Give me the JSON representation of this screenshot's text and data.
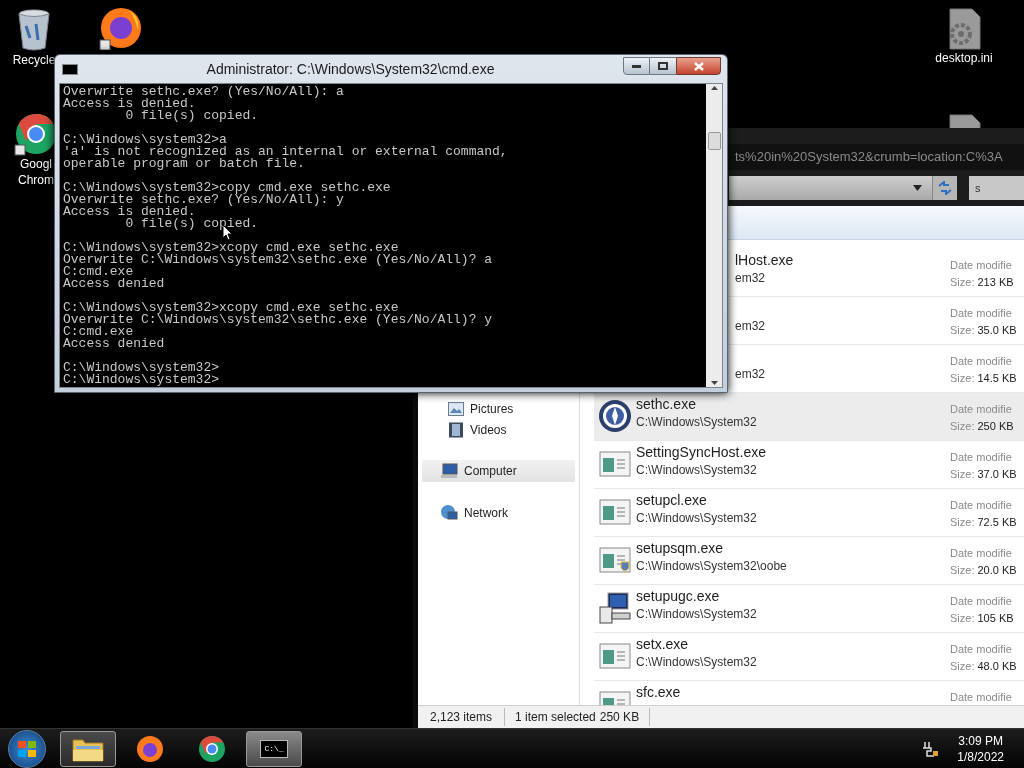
{
  "desktop_icons": [
    {
      "kind": "recycle-bin",
      "label_lines": [
        "Recycle"
      ]
    },
    {
      "kind": "firefox"
    },
    {
      "kind": "chrome",
      "label_lines": [
        "Googl",
        "Chrom"
      ]
    },
    {
      "kind": "settings-file",
      "label_lines": [
        "desktop.ini"
      ]
    },
    {
      "kind": "settings-file"
    }
  ],
  "explorer": {
    "address": "ts%20in%20System32&crumb=location:C%3A",
    "search": {
      "value": "s"
    },
    "nav_items": [
      {
        "label": "Pictures",
        "kind": "pictures",
        "selected": false
      },
      {
        "label": "Videos",
        "kind": "videos",
        "selected": false
      },
      {
        "label": "Computer",
        "kind": "computer",
        "selected": true
      },
      {
        "label": "Network",
        "kind": "network",
        "selected": false
      }
    ],
    "files": [
      {
        "kind": "hidden",
        "selected": false,
        "name": "lHost.exe",
        "path": "em32",
        "date_label": "Date modifie",
        "size_label": "Size:",
        "size": "213 KB"
      },
      {
        "kind": "hidden",
        "selected": false,
        "path": "em32",
        "date_label": "Date modifie",
        "size_label": "Size:",
        "size": "35.0 KB"
      },
      {
        "kind": "hidden",
        "selected": false,
        "path": "em32",
        "date_label": "Date modifie",
        "size_label": "Size:",
        "size": "14.5 KB"
      },
      {
        "kind": "disc",
        "selected": true,
        "name": "sethc.exe",
        "path": "C:\\Windows\\System32",
        "date_label": "Date modifie",
        "size_label": "Size:",
        "size": "250 KB"
      },
      {
        "kind": "app",
        "selected": false,
        "name": "SettingSyncHost.exe",
        "path": "C:\\Windows\\System32",
        "date_label": "Date modifie",
        "size_label": "Size:",
        "size": "37.0 KB"
      },
      {
        "kind": "app",
        "selected": false,
        "name": "setupcl.exe",
        "path": "C:\\Windows\\System32",
        "date_label": "Date modifie",
        "size_label": "Size:",
        "size": "72.5 KB"
      },
      {
        "kind": "app-shield",
        "selected": false,
        "name": "setupsqm.exe",
        "path": "C:\\Windows\\System32\\oobe",
        "date_label": "Date modifie",
        "size_label": "Size:",
        "size": "20.0 KB"
      },
      {
        "kind": "installer",
        "selected": false,
        "name": "setupugc.exe",
        "path": "C:\\Windows\\System32",
        "date_label": "Date modifie",
        "size_label": "Size:",
        "size": "105 KB"
      },
      {
        "kind": "app",
        "selected": false,
        "name": "setx.exe",
        "path": "C:\\Windows\\System32",
        "date_label": "Date modifie",
        "size_label": "Size:",
        "size": "48.0 KB"
      },
      {
        "kind": "app",
        "selected": false,
        "name": "sfc.exe",
        "date_label": "Date modifie"
      }
    ],
    "status": {
      "count": "2,123 items",
      "selection": "1 item selected",
      "selection_size": "250 KB"
    }
  },
  "console_window": {
    "title": "Administrator: C:\\Windows\\System32\\cmd.exe",
    "blocks": [
      [
        "Overwrite sethc.exe? (Yes/No/All): a",
        "Access is denied.",
        "        0 file(s) copied."
      ],
      [
        "C:\\Windows\\system32>a",
        "'a' is not recognized as an internal or external command,",
        "operable program or batch file."
      ],
      [
        "C:\\Windows\\system32>copy cmd.exe sethc.exe",
        "Overwrite sethc.exe? (Yes/No/All): y",
        "Access is denied.",
        "        0 file(s) copied."
      ],
      [
        "C:\\Windows\\system32>xcopy cmd.exe sethc.exe",
        "Overwrite C:\\Windows\\system32\\sethc.exe (Yes/No/All)? a",
        "C:cmd.exe",
        "Access denied"
      ],
      [
        "C:\\Windows\\system32>xcopy cmd.exe sethc.exe",
        "Overwrite C:\\Windows\\system32\\sethc.exe (Yes/No/All)? y",
        "C:cmd.exe",
        "Access denied"
      ],
      [
        "C:\\Windows\\system32>",
        "C:\\Windows\\system32>"
      ]
    ]
  },
  "taskbar": {
    "buttons": [
      {
        "kind": "explorer",
        "selected": false,
        "running": true
      },
      {
        "kind": "firefox",
        "selected": false,
        "running": false
      },
      {
        "kind": "chrome",
        "selected": false,
        "running": false
      },
      {
        "kind": "console",
        "selected": true,
        "running": true,
        "glyph": "C:\\_"
      }
    ],
    "time": "3:09 PM",
    "date": "1/8/2022"
  }
}
